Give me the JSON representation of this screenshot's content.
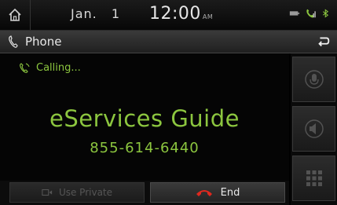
{
  "status_bar": {
    "date": "Jan. 1",
    "time": "12:00",
    "ampm": "AM"
  },
  "title_bar": {
    "title": "Phone"
  },
  "call": {
    "status": "Calling...",
    "name": "eServices Guide",
    "number": "855-614-6440"
  },
  "buttons": {
    "use_private": "Use Private",
    "end": "End"
  },
  "colors": {
    "accent": "#8cc63f",
    "end_icon": "#e0281e"
  }
}
